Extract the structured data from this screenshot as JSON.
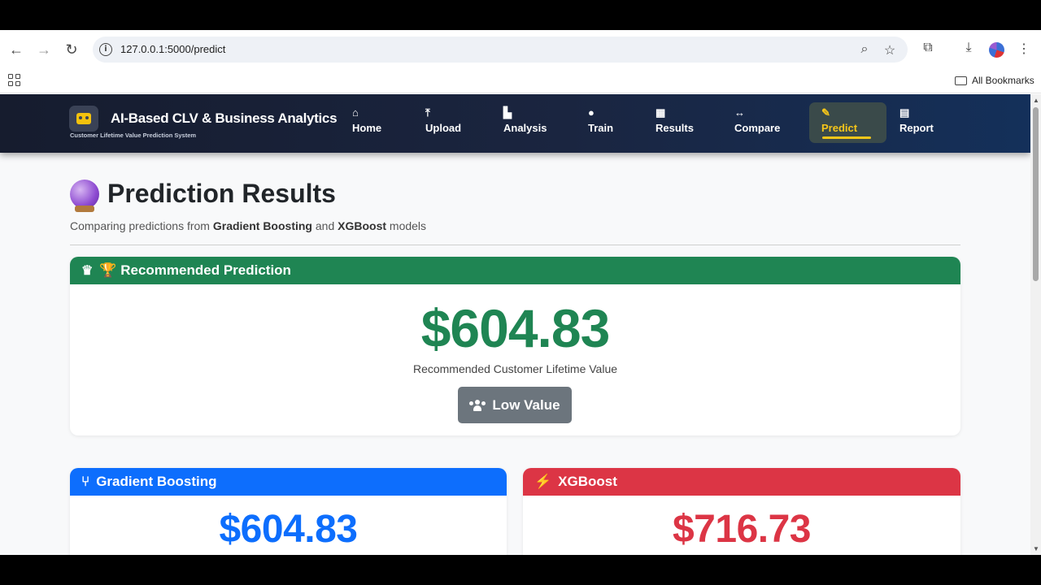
{
  "browser": {
    "url": "127.0.0.1:5000/predict",
    "bookmarks_label": "All Bookmarks"
  },
  "app": {
    "brand_title": "AI-Based CLV & Business Analytics",
    "brand_subtitle": "Customer Lifetime Value Prediction System",
    "nav": [
      {
        "label": "Home",
        "icon": "home-icon"
      },
      {
        "label": "Upload",
        "icon": "upload-icon"
      },
      {
        "label": "Analysis",
        "icon": "chart-icon"
      },
      {
        "label": "Train",
        "icon": "brain-icon"
      },
      {
        "label": "Results",
        "icon": "table-icon"
      },
      {
        "label": "Compare",
        "icon": "arrows-icon"
      },
      {
        "label": "Predict",
        "icon": "pencil-icon",
        "active": true
      },
      {
        "label": "Report",
        "icon": "document-icon"
      }
    ]
  },
  "page": {
    "title": "Prediction Results",
    "subtitle_prefix": "Comparing predictions from ",
    "model_a": "Gradient Boosting",
    "subtitle_and": " and ",
    "model_b": "XGBoost",
    "subtitle_suffix": " models"
  },
  "recommended": {
    "header": "🏆 Recommended Prediction",
    "value": "$604.83",
    "caption": "Recommended Customer Lifetime Value",
    "segment": "Low Value"
  },
  "models": [
    {
      "name": "Gradient Boosting",
      "value": "$604.83",
      "color": "#0d6efd"
    },
    {
      "name": "XGBoost",
      "value": "$716.73",
      "color": "#dc3545"
    }
  ]
}
